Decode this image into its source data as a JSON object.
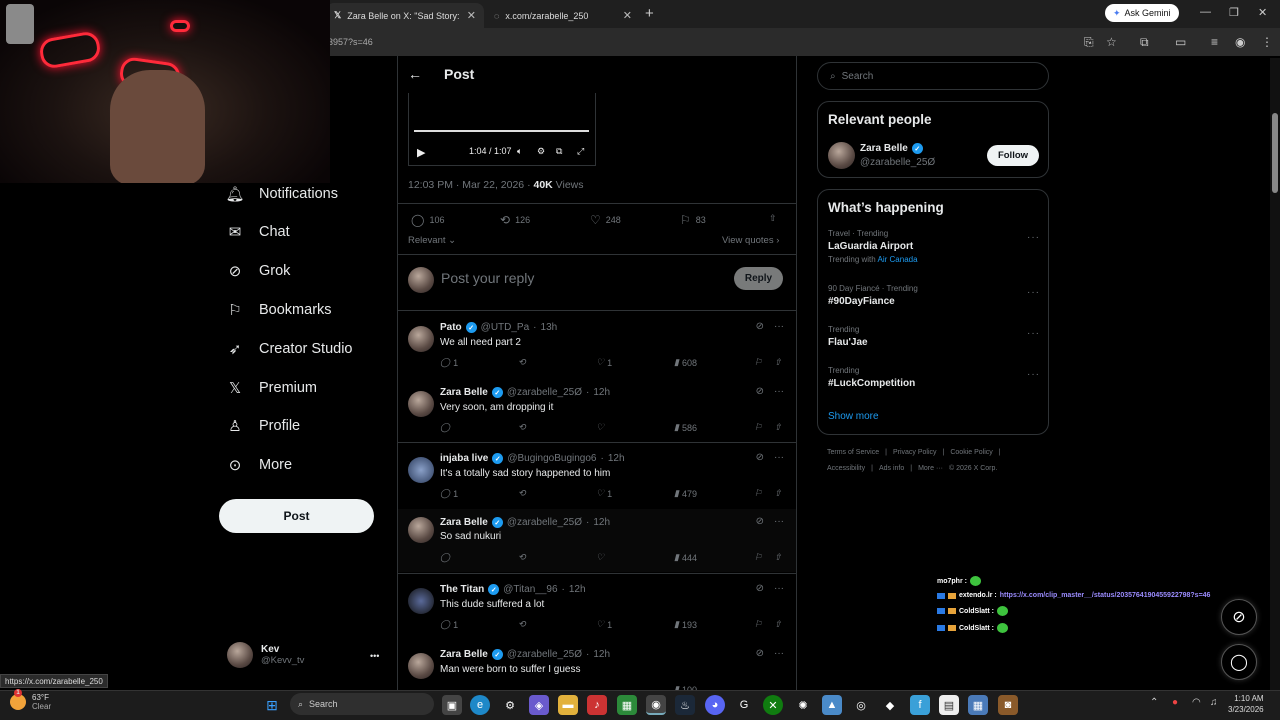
{
  "browser": {
    "tabs": [
      {
        "title": "Zara Belle on X: \"Sad Story: His",
        "active": true
      },
      {
        "title": "x.com/zarabelle_250",
        "active": false
      }
    ],
    "ask_gemini": "Ask Gemini",
    "url_fragment": "3957?s=46",
    "status_link": "https://x.com/zarabelle_250"
  },
  "sidebar": {
    "items": [
      {
        "label": "Notifications",
        "icon": "bell-icon"
      },
      {
        "label": "Chat",
        "icon": "mail-icon"
      },
      {
        "label": "Grok",
        "icon": "grok-icon"
      },
      {
        "label": "Bookmarks",
        "icon": "bookmark-icon"
      },
      {
        "label": "Creator Studio",
        "icon": "rocket-icon"
      },
      {
        "label": "Premium",
        "icon": "x-logo-icon"
      },
      {
        "label": "Profile",
        "icon": "person-icon"
      },
      {
        "label": "More",
        "icon": "more-circle-icon"
      }
    ],
    "post_button": "Post",
    "account": {
      "name": "Kev",
      "handle": "@Kevv_tv",
      "menu": "•••"
    }
  },
  "main": {
    "header_title": "Post",
    "video": {
      "time": "1:04 / 1:07",
      "progress": 0.95
    },
    "meta": {
      "time": "12:03 PM · Mar 22, 2026 · ",
      "views_count": "40K",
      "views_label": " Views"
    },
    "stats": {
      "replies": "106",
      "reposts": "126",
      "likes": "248",
      "bookmarks": "83"
    },
    "sort_label": "Relevant",
    "view_quotes": "View quotes",
    "reply_placeholder": "Post your reply",
    "reply_button": "Reply",
    "replies": [
      {
        "name": "Pato",
        "handle": "@UTD_Pa",
        "time": "13h",
        "text": "We all need part 2",
        "replies": "1",
        "reposts": "",
        "likes": "1",
        "views": "608"
      },
      {
        "name": "Zara Belle",
        "handle": "@zarabelle_25Ø",
        "time": "12h",
        "text": "Very soon, am dropping it",
        "replies": "",
        "reposts": "",
        "likes": "",
        "views": "586"
      },
      {
        "name": "injaba live",
        "handle": "@BugingoBugingo6",
        "time": "12h",
        "text": "It's a totally sad story happened to him",
        "replies": "1",
        "reposts": "",
        "likes": "1",
        "views": "479"
      },
      {
        "name": "Zara Belle",
        "handle": "@zarabelle_25Ø",
        "time": "12h",
        "text": "So sad nukuri",
        "replies": "",
        "reposts": "",
        "likes": "",
        "views": "444"
      },
      {
        "name": "The Titan",
        "handle": "@Titan__96",
        "time": "12h",
        "text": "This dude suffered a lot",
        "replies": "1",
        "reposts": "",
        "likes": "1",
        "views": "193"
      },
      {
        "name": "Zara Belle",
        "handle": "@zarabelle_25Ø",
        "time": "12h",
        "text": "Man were born to suffer I guess",
        "replies": "",
        "reposts": "",
        "likes": "",
        "views": "100"
      }
    ]
  },
  "right": {
    "search_placeholder": "Search",
    "relevant_title": "Relevant people",
    "person": {
      "name": "Zara Belle",
      "handle": "@zarabelle_25Ø",
      "follow": "Follow"
    },
    "happening_title": "What’s happening",
    "trends": [
      {
        "context": "Travel · Trending",
        "title": "LaGuardia Airport",
        "with_prefix": "Trending with ",
        "with_link": "Air Canada"
      },
      {
        "context": "90 Day Fiancé · Trending",
        "title": "#90DayFiance"
      },
      {
        "context": "Trending",
        "title": "Flau'Jae"
      },
      {
        "context": "Trending",
        "title": "#LuckCompetition"
      }
    ],
    "show_more": "Show more",
    "footer1": [
      "Terms of Service",
      "|",
      "Privacy Policy",
      "|",
      "Cookie Policy",
      "|"
    ],
    "footer2": [
      "Accessibility",
      "|",
      "Ads info",
      "|",
      "More ···",
      "© 2026 X Corp."
    ]
  },
  "chat_overlay": [
    {
      "user": "mo7phr :",
      "msg": ""
    },
    {
      "user": "extendo.lr :",
      "msg": "https://x.com/clip_master__/status/2035764190455922798?s=46"
    },
    {
      "user": "ColdSlatt :",
      "msg": ""
    },
    {
      "user": "ColdSlatt :",
      "msg": ""
    }
  ],
  "taskbar": {
    "weather_temp": "63°F",
    "weather_desc": "Clear",
    "weather_alert": "1",
    "search": "Search",
    "time": "1:10 AM",
    "date": "3/23/2026"
  }
}
